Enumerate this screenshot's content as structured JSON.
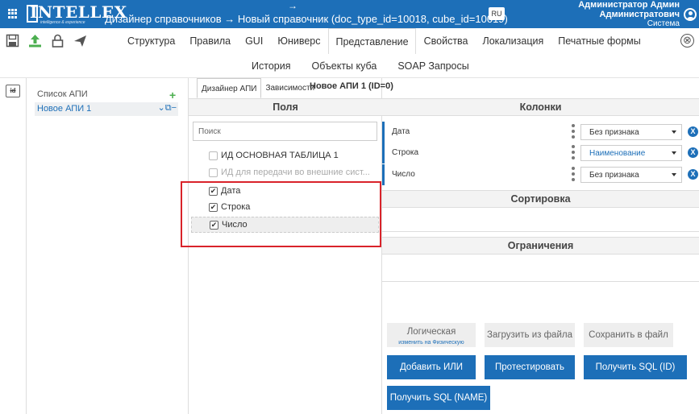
{
  "header": {
    "logo": "INTELLEX",
    "logo_tagline": "intelligence & experience",
    "crumb_arrow": "→",
    "title": "Дизайнер справочников  →  Новый справочник (doc_type_id=10018, cube_id=10019)",
    "lang": "RU",
    "user_name_1": "Администратор Админ",
    "user_name_2": "Администратович",
    "user_role": "Система"
  },
  "toolbar": {
    "icons": [
      "save-icon",
      "upload-icon",
      "lock-icon",
      "send-icon"
    ],
    "tabs": [
      "Структура",
      "Правила",
      "GUI",
      "Юниверс",
      "Представление",
      "Свойства",
      "Локализация",
      "Печатные формы"
    ],
    "active_tab": "Представление",
    "tabs_row2": [
      "История",
      "Объекты куба",
      "SOAP Запросы"
    ],
    "close": "⊗"
  },
  "gutter": {
    "id_label": "id"
  },
  "api_list": {
    "title": "Список АПИ",
    "add": "+",
    "items": [
      {
        "label": "Новое АПИ 1",
        "icons": "⌄⧉−"
      }
    ]
  },
  "fields_panel": {
    "inner_tabs": [
      "Дизайнер АПИ",
      "Зависимости"
    ],
    "api_heading": "Новое АПИ 1 (ID=0)",
    "section_title": "Поля",
    "search_placeholder": "Поиск",
    "fields": [
      {
        "label": "ИД ОСНОВНАЯ ТАБЛИЦА 1",
        "checked": false,
        "disabled": false
      },
      {
        "label": "ИД для передачи во внешние сист...",
        "checked": false,
        "disabled": true
      },
      {
        "label": "Дата",
        "checked": true,
        "disabled": false
      },
      {
        "label": "Строка",
        "checked": true,
        "disabled": false
      },
      {
        "label": "Число",
        "checked": true,
        "disabled": false
      }
    ],
    "check_mark": "✔"
  },
  "columns_panel": {
    "title": "Колонки",
    "rows": [
      {
        "name": "Дата",
        "value": "Без признака"
      },
      {
        "name": "Строка",
        "value": "Наименование"
      },
      {
        "name": "Число",
        "value": "Без признака"
      }
    ],
    "remove_label": "X",
    "sort_title": "Сортировка",
    "limits_title": "Ограничения"
  },
  "buttons": {
    "logic": "Логическая",
    "logic_sub": "изменить на Физическую",
    "load_file": "Загрузить из файла",
    "save_file": "Сохранить в файл",
    "add_or": "Добавить ИЛИ",
    "test": "Протестировать",
    "get_sql_id": "Получить SQL (ID)",
    "get_sql_name": "Получить SQL (NAME)"
  },
  "colors": {
    "brand": "#1d6fb8",
    "highlight": "#d9232a",
    "add": "#4caf50"
  }
}
